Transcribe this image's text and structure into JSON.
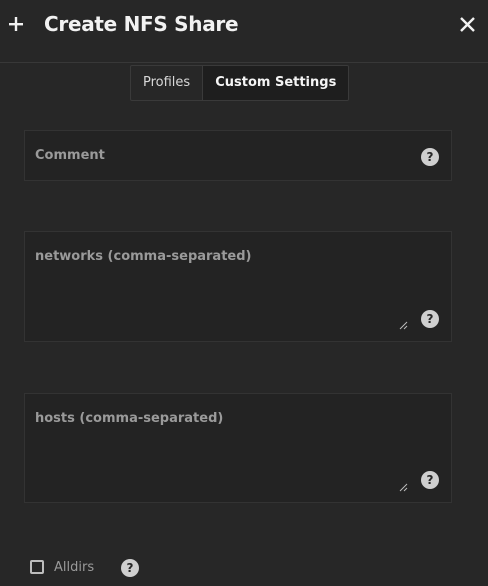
{
  "header": {
    "plus_icon": "plus-icon",
    "title": "Create NFS Share",
    "close_icon": "close-icon"
  },
  "tabs": [
    {
      "label": "Profiles",
      "active": false
    },
    {
      "label": "Custom Settings",
      "active": true
    }
  ],
  "form": {
    "comment": {
      "label": "Comment",
      "value": "",
      "help": "?"
    },
    "networks": {
      "label": "networks (comma-separated)",
      "value": "",
      "help": "?"
    },
    "hosts": {
      "label": "hosts (comma-separated)",
      "value": "",
      "help": "?"
    },
    "alldirs": {
      "label": "Alldirs",
      "checked": false,
      "help": "?"
    }
  },
  "colors": {
    "background": "#272727",
    "field_background": "#232323",
    "label": "#9a9a9a",
    "help_icon": "#cfcfcf"
  }
}
